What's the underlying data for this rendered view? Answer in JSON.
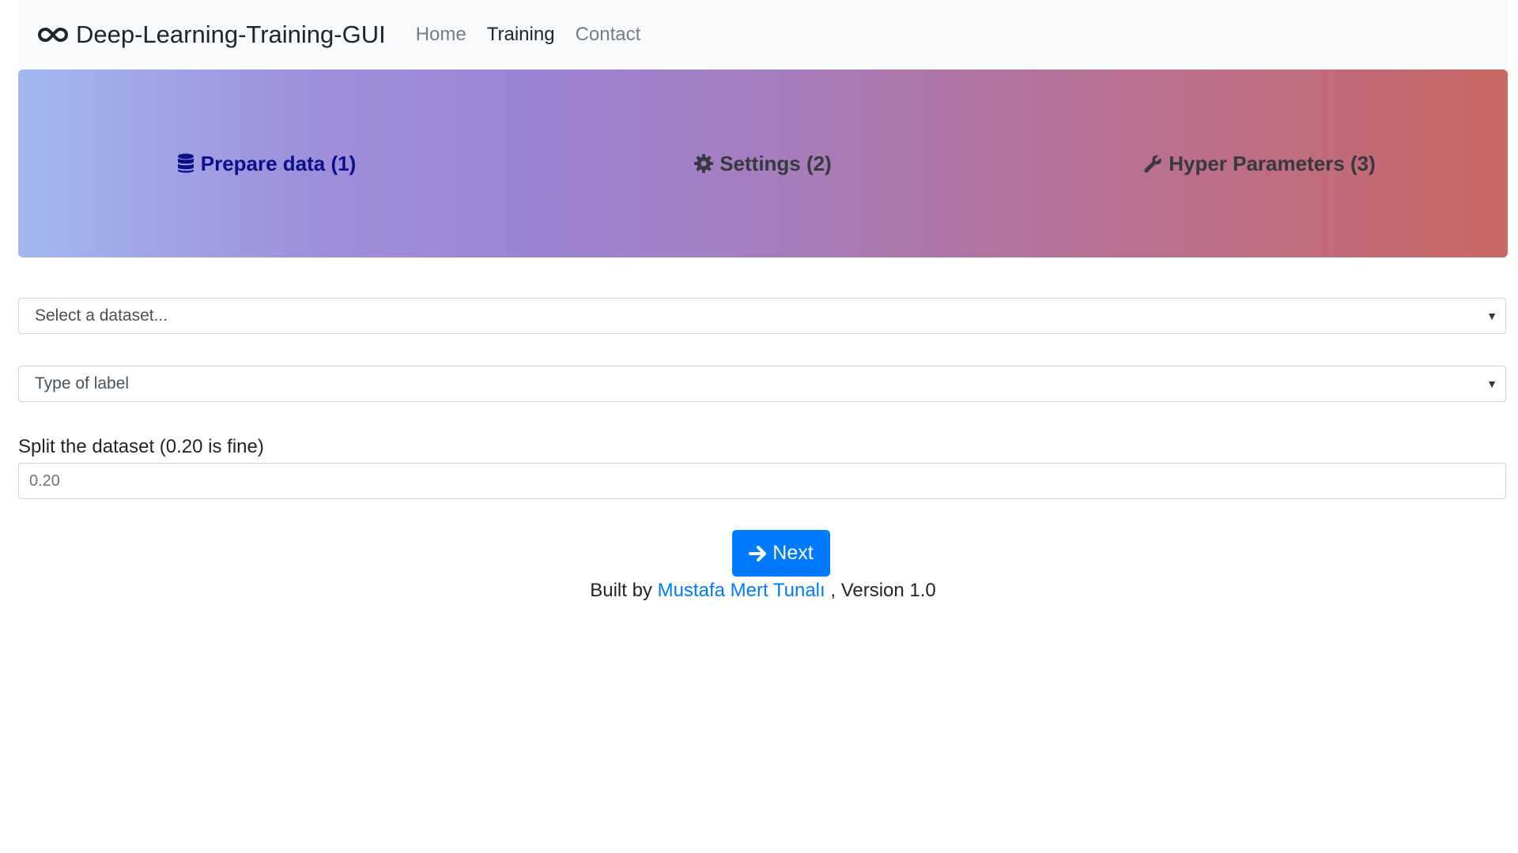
{
  "navbar": {
    "brand_icon": "infinity-icon",
    "brand": "Deep-Learning-Training-GUI",
    "links": [
      {
        "label": "Home",
        "active": false
      },
      {
        "label": "Training",
        "active": true
      },
      {
        "label": "Contact",
        "active": false
      }
    ]
  },
  "steps": [
    {
      "icon": "database-icon",
      "label": "Prepare data (1)",
      "active": true
    },
    {
      "icon": "gear-icon",
      "label": "Settings (2)",
      "active": false
    },
    {
      "icon": "wrench-icon",
      "label": "Hyper Parameters (3)",
      "active": false
    }
  ],
  "form": {
    "dataset_select": {
      "selected": "Select a dataset..."
    },
    "label_select": {
      "selected": "Type of label"
    },
    "split_label": "Split the dataset (0.20 is fine)",
    "split_placeholder": "0.20",
    "next_button": "Next"
  },
  "footer": {
    "prefix": "Built by",
    "author": "Mustafa Mert Tunalı",
    "suffix": ", Version 1.0"
  },
  "colors": {
    "primary": "#007bff",
    "active_step": "#0b0f8a",
    "navbar_bg": "#f8f9fa"
  }
}
